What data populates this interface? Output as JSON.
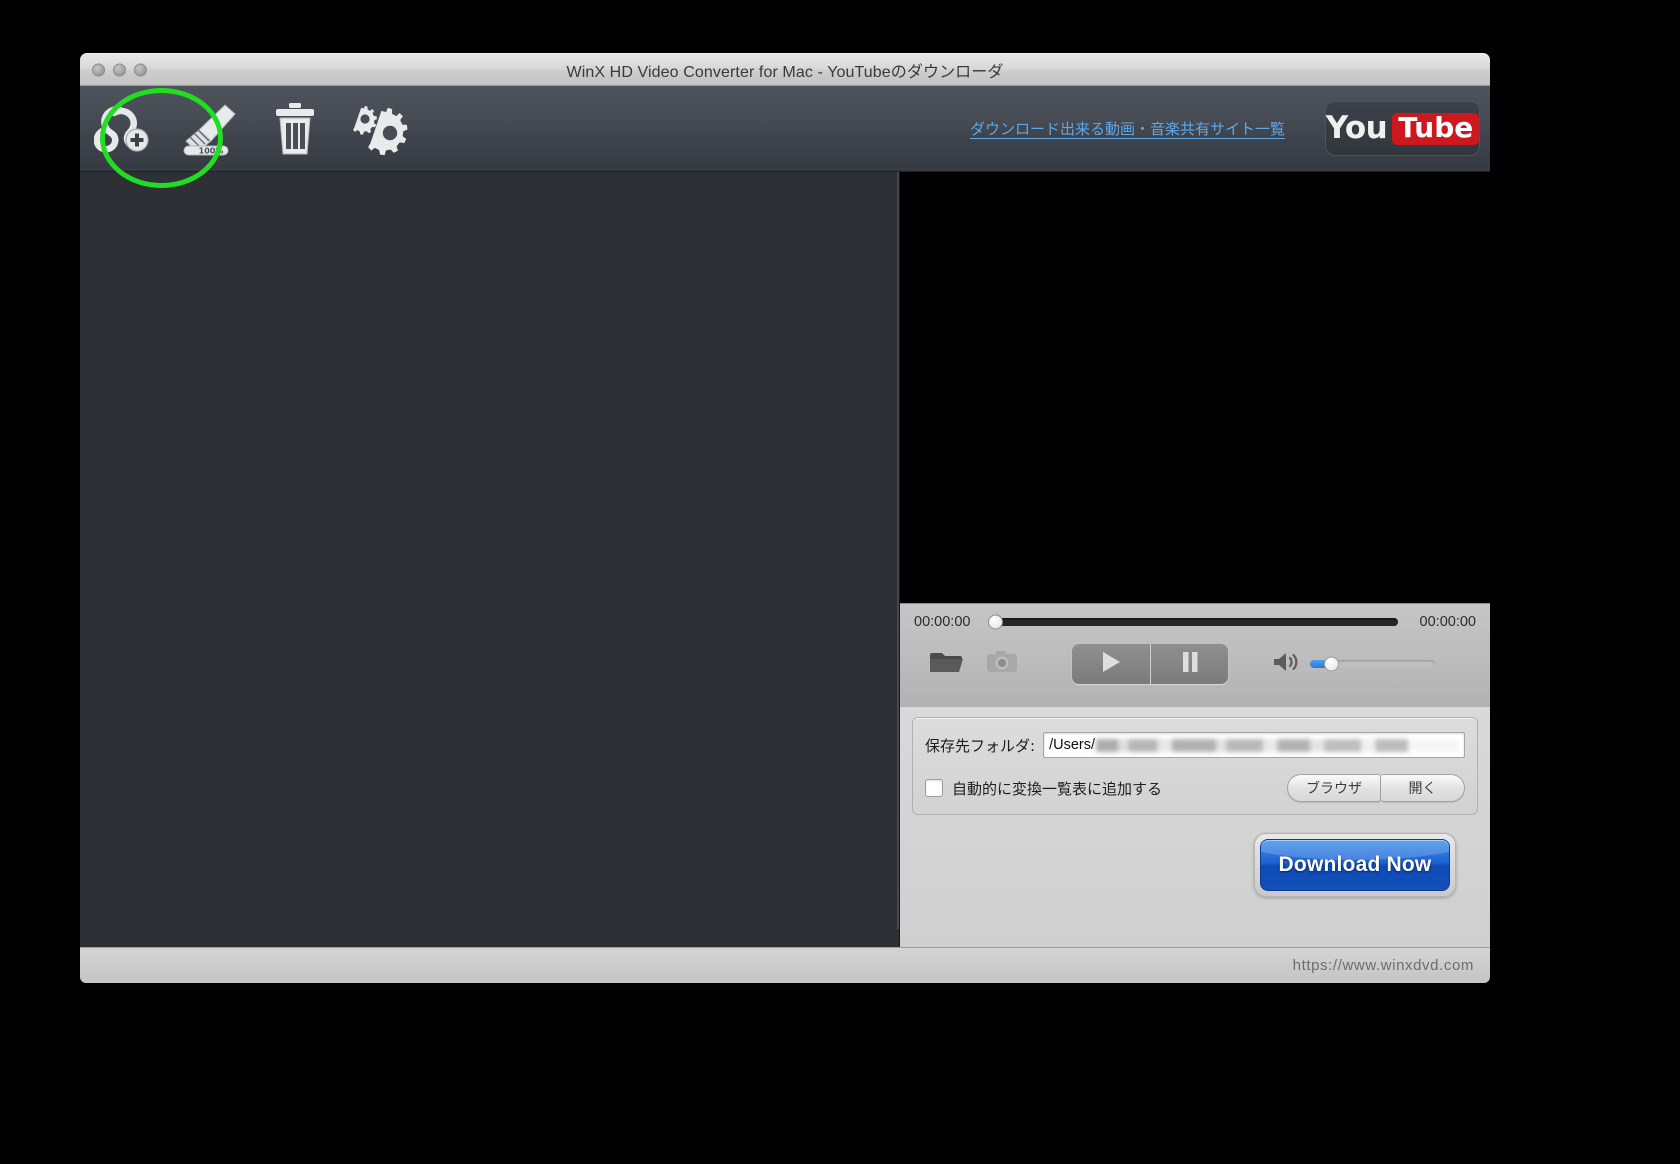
{
  "window": {
    "title": "WinX HD Video Converter for Mac - YouTubeのダウンローダ"
  },
  "toolbar": {
    "buttons": [
      {
        "name": "add-url-button",
        "icon": "link-add-icon",
        "label": ""
      },
      {
        "name": "clean-button",
        "icon": "brush-100-percent-icon",
        "label": "100%"
      },
      {
        "name": "delete-button",
        "icon": "trash-icon",
        "label": ""
      },
      {
        "name": "settings-button",
        "icon": "gears-icon",
        "label": ""
      }
    ],
    "supported_sites_link": "ダウンロード出来る動画・音楽共有サイト一覧",
    "youtube_badge": {
      "you": "You",
      "tube": "Tube"
    }
  },
  "player": {
    "current_time": "00:00:00",
    "total_time": "00:00:00",
    "seek_position_percent": 0,
    "volume_percent": 14,
    "controls": [
      {
        "name": "open-folder-button",
        "icon": "folder-open-icon"
      },
      {
        "name": "snapshot-button",
        "icon": "camera-icon"
      },
      {
        "name": "play-button",
        "icon": "play-icon"
      },
      {
        "name": "pause-button",
        "icon": "pause-icon"
      },
      {
        "name": "volume-button",
        "icon": "speaker-icon"
      }
    ]
  },
  "settings": {
    "folder_label": "保存先フォルダ:",
    "folder_value": "/Users/",
    "auto_add_label": "自動的に変換一覧表に追加する",
    "auto_add_checked": false,
    "browse_button": "ブラウザ",
    "open_button": "開く"
  },
  "actions": {
    "download_now": "Download Now"
  },
  "status": {
    "url": "https://www.winxdvd.com"
  },
  "colors": {
    "accent_link": "#5fa8e8",
    "youtube_red": "#cc181e",
    "download_blue": "#1f63d4",
    "highlight_green": "#22dd22",
    "toolbar_bg": "#464b54",
    "list_bg": "#2d3035"
  }
}
